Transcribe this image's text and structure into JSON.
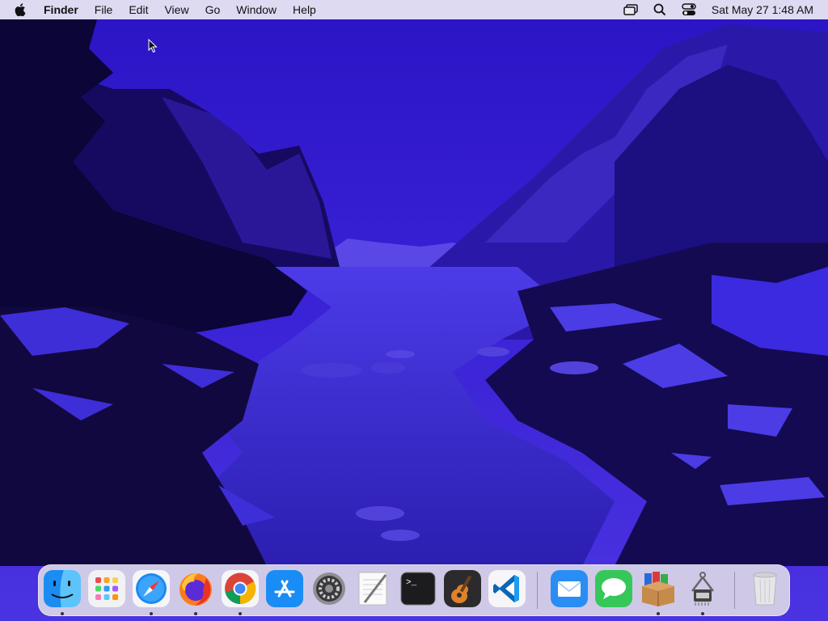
{
  "menubar": {
    "app_name": "Finder",
    "menus": [
      "File",
      "Edit",
      "View",
      "Go",
      "Window",
      "Help"
    ],
    "clock": "Sat May 27  1:48 AM",
    "status_icons": [
      "screen-mirroring-icon",
      "search-icon",
      "control-center-icon"
    ]
  },
  "dock": {
    "apps": [
      {
        "name": "Finder",
        "running": true
      },
      {
        "name": "Launchpad",
        "running": false
      },
      {
        "name": "Safari",
        "running": true
      },
      {
        "name": "Firefox",
        "running": true
      },
      {
        "name": "Google Chrome",
        "running": true
      },
      {
        "name": "App Store",
        "running": false
      },
      {
        "name": "System Preferences",
        "running": false
      },
      {
        "name": "TextEdit",
        "running": false
      },
      {
        "name": "Terminal",
        "running": false
      },
      {
        "name": "GarageBand",
        "running": false
      },
      {
        "name": "Visual Studio Code",
        "running": false
      },
      {
        "name": "Mail",
        "running": false
      },
      {
        "name": "Messages",
        "running": false
      },
      {
        "name": "Archive Utility",
        "running": true
      },
      {
        "name": "System Information",
        "running": true
      },
      {
        "name": "Trash",
        "running": false
      }
    ]
  },
  "colors": {
    "sky": "#3a1fd0",
    "water": "#3a2ad8",
    "silhouette": "#0a0530",
    "mountain": "#2a17a8"
  }
}
